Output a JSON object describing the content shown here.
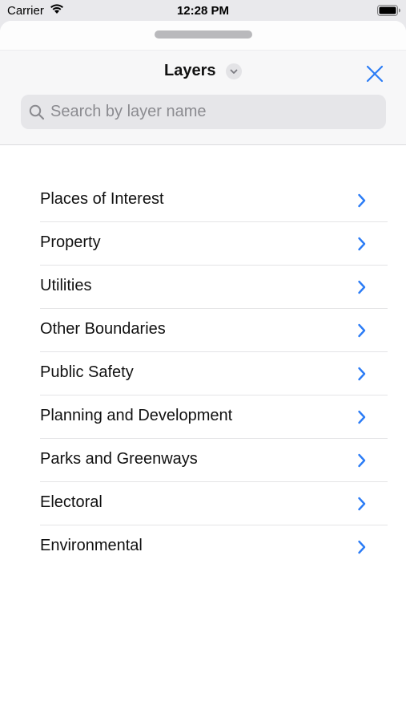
{
  "status_bar": {
    "carrier": "Carrier",
    "time": "12:28 PM"
  },
  "header": {
    "title": "Layers",
    "search_placeholder": "Search by layer name"
  },
  "colors": {
    "accent": "#2b7cf6",
    "background": "#ffffff",
    "header_background": "#f7f7f8",
    "search_background": "#e6e6e9"
  },
  "icons": {
    "status": [
      "wifi-icon",
      "battery-icon"
    ],
    "header": [
      "chevron-down-icon",
      "close-icon",
      "search-icon"
    ],
    "row": "chevron-right-icon"
  },
  "layers": [
    {
      "label": "Places of Interest"
    },
    {
      "label": "Property"
    },
    {
      "label": "Utilities"
    },
    {
      "label": "Other Boundaries"
    },
    {
      "label": "Public Safety"
    },
    {
      "label": "Planning and Development"
    },
    {
      "label": "Parks and Greenways"
    },
    {
      "label": "Electoral"
    },
    {
      "label": "Environmental"
    }
  ]
}
